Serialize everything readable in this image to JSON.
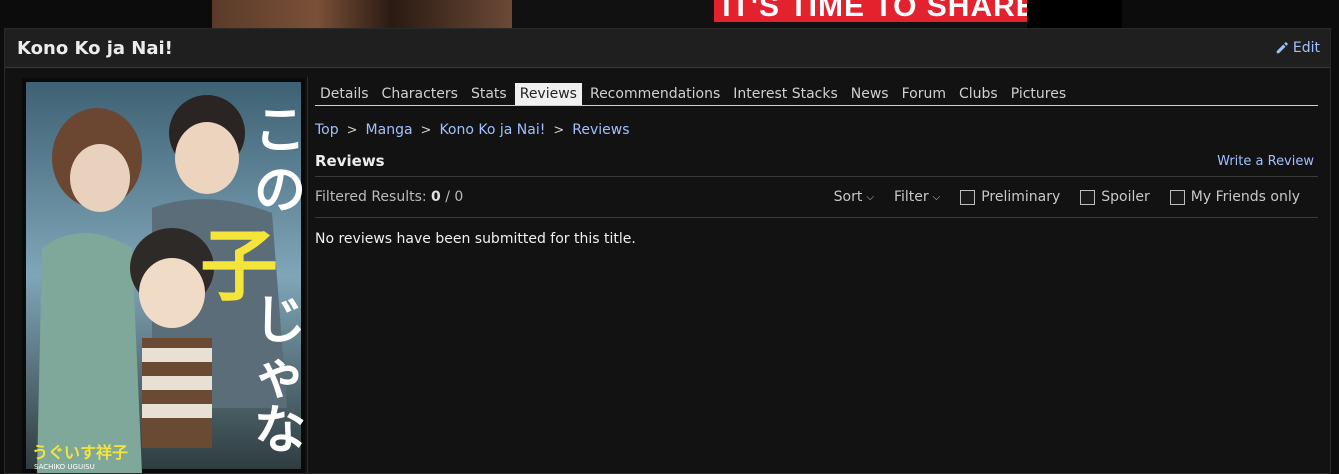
{
  "ad": {
    "banner_text": "IT'S TIME TO SHARE!"
  },
  "header": {
    "title": "Kono Ko ja Nai!",
    "edit_label": "Edit"
  },
  "cover": {
    "author_jp": "うぐいす祥子",
    "author_en": "SACHIKO UGUISU"
  },
  "tabs": [
    {
      "label": "Details"
    },
    {
      "label": "Characters"
    },
    {
      "label": "Stats"
    },
    {
      "label": "Reviews",
      "active": true
    },
    {
      "label": "Recommendations"
    },
    {
      "label": "Interest Stacks"
    },
    {
      "label": "News"
    },
    {
      "label": "Forum"
    },
    {
      "label": "Clubs"
    },
    {
      "label": "Pictures"
    }
  ],
  "breadcrumb": [
    {
      "label": "Top"
    },
    {
      "label": "Manga"
    },
    {
      "label": "Kono Ko ja Nai!"
    },
    {
      "label": "Reviews"
    }
  ],
  "breadcrumb_sep": ">",
  "reviews": {
    "section_title": "Reviews",
    "write_label": "Write a Review",
    "filtered_label": "Filtered Results:",
    "filtered_count": "0",
    "filtered_total": "/ 0",
    "sort_label": "Sort",
    "filter_label": "Filter",
    "checkboxes": [
      {
        "label": "Preliminary"
      },
      {
        "label": "Spoiler"
      },
      {
        "label": "My Friends only"
      }
    ],
    "empty_message": "No reviews have been submitted for this title."
  },
  "colors": {
    "link": "#9fc0ff",
    "background": "#121212",
    "header": "#1f1f1f"
  }
}
